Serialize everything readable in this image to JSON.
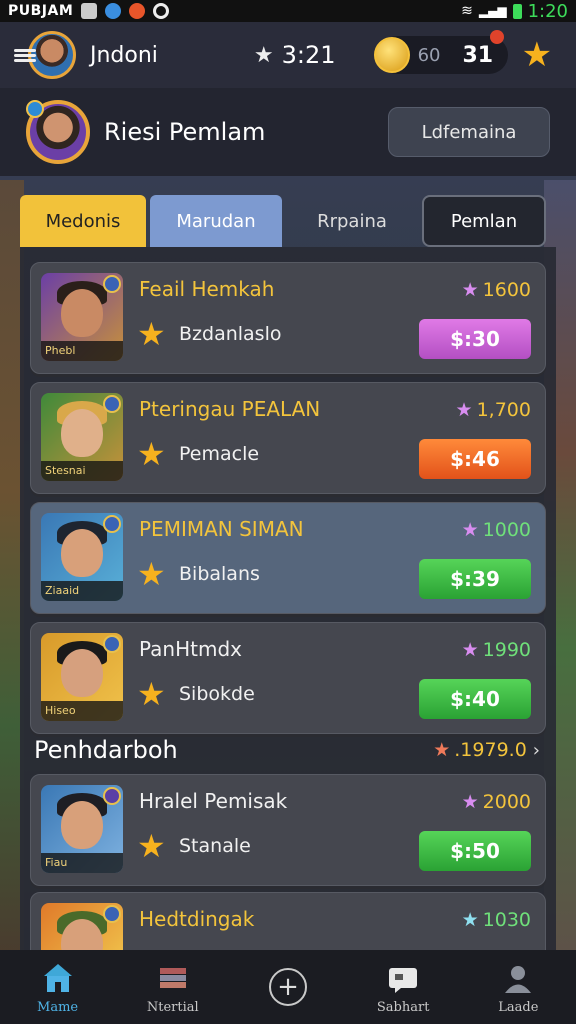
{
  "status_bar": {
    "carrier": "PUBJAM",
    "time": "1:20"
  },
  "top_bar": {
    "username": "Jndoni",
    "timer": "3:21",
    "coins": "60",
    "gems": "31"
  },
  "profile": {
    "title": "Riesi Pemlam",
    "button": "Ldfemaina"
  },
  "tabs": [
    {
      "label": "Medonis",
      "active": true
    },
    {
      "label": "Marudan",
      "active": false
    },
    {
      "label": "Rrpaina",
      "active": false
    },
    {
      "label": "Pemlan",
      "active": false
    }
  ],
  "items": [
    {
      "name": "Feail Hemkah",
      "subtitle": "Bzdanlaslo",
      "score": "1600",
      "price": "$:30",
      "price_color": "#d66be0",
      "portrait_label": "Phebl",
      "card_highlight": false
    },
    {
      "name": "Pteringau PEALAN",
      "subtitle": "Pemacle",
      "score": "1,700",
      "price": "$:46",
      "price_color": "#f06a2a",
      "portrait_label": "Stesnai",
      "card_highlight": false
    },
    {
      "name": "PEMIMAN SIMAN",
      "subtitle": "Bibalans",
      "score": "1000",
      "price": "$:39",
      "price_color": "#3fbe45",
      "portrait_label": "Ziaaid",
      "card_highlight": true
    },
    {
      "name": "PanHtmdx",
      "subtitle": "Sibokde",
      "score": "1990",
      "price": "$:40",
      "price_color": "#3fbe45",
      "portrait_label": "Hiseo",
      "card_highlight": false
    }
  ],
  "section": {
    "title": "Penhdarboh",
    "score": ".1979.0"
  },
  "items_after": [
    {
      "name": "Hralel Pemisak",
      "subtitle": "Stanale",
      "score": "2000",
      "price": "$:50",
      "price_color": "#3fbe45",
      "portrait_label": "Fiau",
      "card_highlight": false
    },
    {
      "name": "Hedtdingak",
      "subtitle": "",
      "score": "1030",
      "price": "",
      "price_color": "#3fbe45",
      "portrait_label": "",
      "card_highlight": false
    }
  ],
  "bottom_nav": [
    {
      "label": "Mame",
      "icon": "home-icon",
      "active": true
    },
    {
      "label": "Ntertial",
      "icon": "books-icon",
      "active": false
    },
    {
      "label": "",
      "icon": "plus-icon",
      "active": false
    },
    {
      "label": "Sabhart",
      "icon": "chat-icon",
      "active": false
    },
    {
      "label": "Laade",
      "icon": "user-icon",
      "active": false
    }
  ],
  "colors": {
    "gold": "#f3c43c",
    "purple": "#d66be0",
    "orange": "#f06a2a",
    "green": "#3fbe45"
  }
}
